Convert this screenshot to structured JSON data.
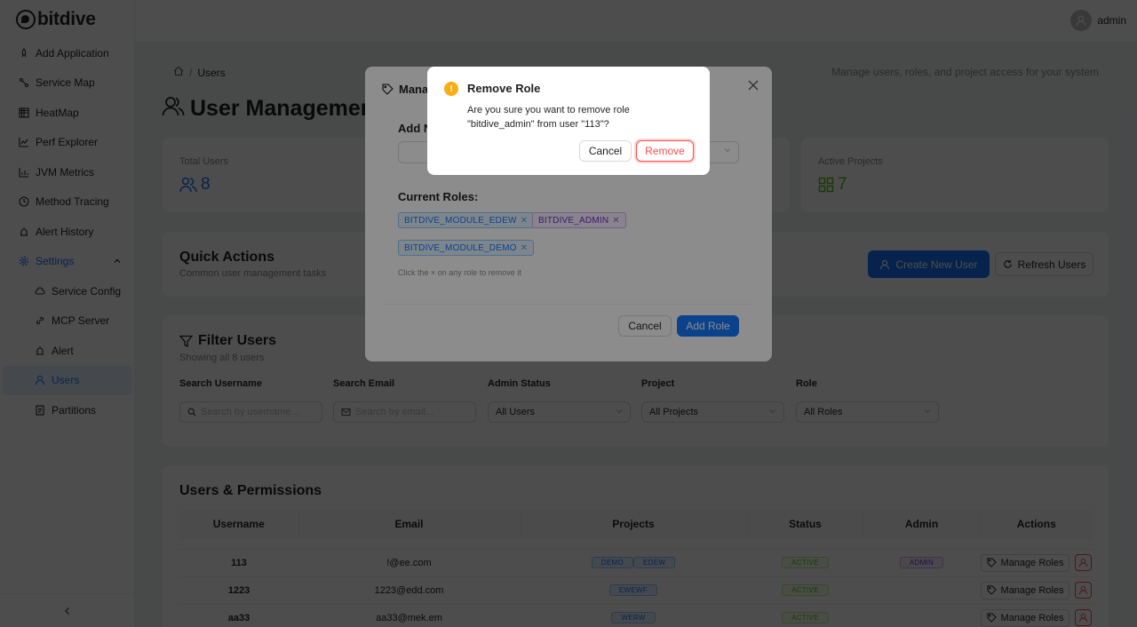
{
  "app": {
    "logo_text": "bitdive"
  },
  "colors": {
    "primary": "#1677ff",
    "danger": "#ff4d4f",
    "warning": "#faad14",
    "success": "#52c41a",
    "admin": "#722ed1"
  },
  "sidebar": {
    "items": [
      {
        "label": "Add Application",
        "icon": "rocket-icon"
      },
      {
        "label": "Service Map",
        "icon": "service-map-icon"
      },
      {
        "label": "HeatMap",
        "icon": "heatmap-icon"
      },
      {
        "label": "Perf Explorer",
        "icon": "chart-icon"
      },
      {
        "label": "JVM Metrics",
        "icon": "bar-chart-icon"
      },
      {
        "label": "Method Tracing",
        "icon": "clock-icon"
      },
      {
        "label": "Alert History",
        "icon": "alarm-icon"
      },
      {
        "label": "Settings",
        "icon": "gear-icon"
      },
      {
        "label": "Service Config",
        "icon": "cloud-icon"
      },
      {
        "label": "MCP Server",
        "icon": "link-icon"
      },
      {
        "label": "Alert",
        "icon": "alarm-icon"
      },
      {
        "label": "Users",
        "icon": "user-icon"
      },
      {
        "label": "Partitions",
        "icon": "document-icon"
      }
    ]
  },
  "header": {
    "username": "admin"
  },
  "breadcrumb": {
    "current": "Users"
  },
  "page": {
    "description": "Manage users, roles, and project access for your system",
    "title": "User Management I"
  },
  "stats": [
    {
      "label": "Total Users",
      "value": "8"
    },
    {
      "label": "Active Projects",
      "value": "7"
    }
  ],
  "quick_actions": {
    "title": "Quick Actions",
    "subtitle": "Common user management tasks",
    "create_label": "Create New User",
    "refresh_label": "Refresh Users"
  },
  "filters": {
    "title": "Filter Users",
    "subtitle": "Showing all 8 users",
    "username_label": "Search Username",
    "username_placeholder": "Search by username...",
    "email_label": "Search Email",
    "email_placeholder": "Search by email...",
    "admin_label": "Admin Status",
    "admin_value": "All Users",
    "project_label": "Project",
    "project_value": "All Projects",
    "role_label": "Role",
    "role_value": "All Roles"
  },
  "table": {
    "title": "Users & Permissions",
    "columns": [
      "Username",
      "Email",
      "Projects",
      "Status",
      "Admin",
      "Actions"
    ],
    "manage_label": "Manage Roles",
    "rows": [
      {
        "username": "113",
        "email": "!@ee.com",
        "projects": [
          "DEMO",
          "EDEW"
        ],
        "status": "ACTIVE",
        "admin": "ADMIN"
      },
      {
        "username": "1223",
        "email": "1223@edd.com",
        "projects": [
          "EWEWF"
        ],
        "status": "ACTIVE",
        "admin": ""
      },
      {
        "username": "aa33",
        "email": "aa33@mek.em",
        "projects": [
          "WERW"
        ],
        "status": "ACTIVE",
        "admin": ""
      }
    ]
  },
  "manage_modal": {
    "title": "Manag",
    "add_label": "Add N",
    "current_roles_label": "Current Roles:",
    "roles": [
      "BITDIVE_MODULE_EDEW",
      "BITDIVE_ADMIN",
      "BITDIVE_MODULE_DEMO"
    ],
    "hint": "Click the × on any role to remove it",
    "cancel_label": "Cancel",
    "add_role_label": "Add Role"
  },
  "confirm_modal": {
    "title": "Remove Role",
    "message": "Are you sure you want to remove role \"bitdive_admin\" from user \"113\"?",
    "cancel_label": "Cancel",
    "remove_label": "Remove"
  }
}
